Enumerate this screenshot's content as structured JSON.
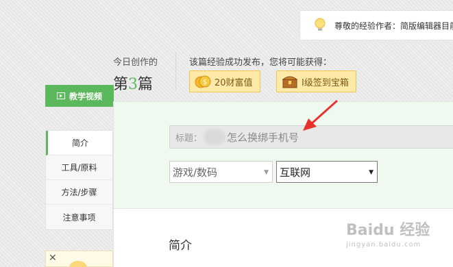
{
  "notice": {
    "text": "尊敬的经验作者：简版编辑器目前"
  },
  "today": {
    "label": "今日创作的",
    "prefix": "第",
    "count": "3",
    "suffix": "篇"
  },
  "reward": {
    "title": "该篇经验成功发布，您将可能获得：",
    "wealth_label": "20财富值",
    "chest_label": "I级签到宝箱"
  },
  "sidebar": {
    "video_label": "教学视频",
    "items": [
      {
        "label": "简介",
        "active": true
      },
      {
        "label": "工具/原料",
        "active": false
      },
      {
        "label": "方法/步骤",
        "active": false
      },
      {
        "label": "注意事项",
        "active": false
      }
    ]
  },
  "ad": {
    "close_label": "✕"
  },
  "editor": {
    "title_label": "标题：",
    "title_value": "怎么换绑手机号",
    "category_value": "游戏/数码",
    "subcategory_value": "互联网",
    "intro_heading": "简介"
  },
  "watermark": {
    "text": "Baidu 经验",
    "sub": "jingyan.baidu.com"
  },
  "colors": {
    "accent_green": "#5cb85c",
    "annotation_red": "#e8322d",
    "badge_bg": "#ffe9a8"
  }
}
